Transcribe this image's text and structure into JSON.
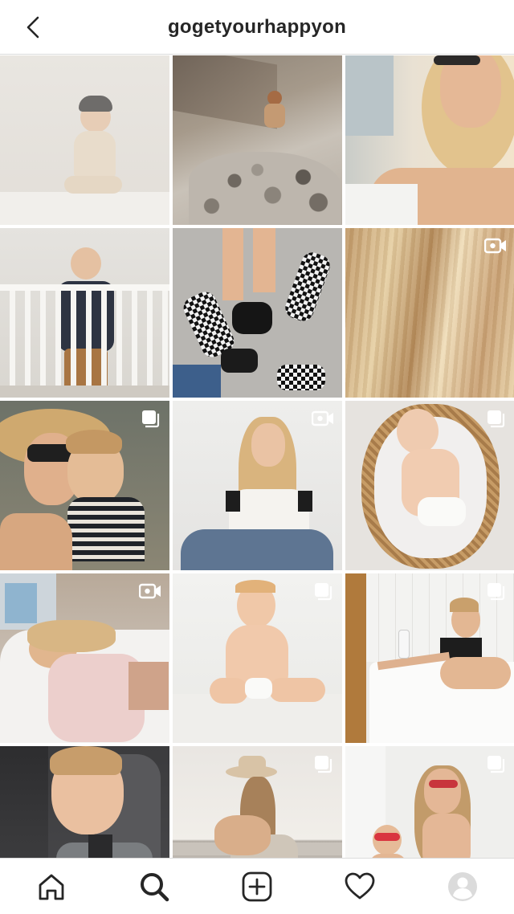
{
  "header": {
    "title": "gogetyourhappyon",
    "back_icon": "chevron-left-icon"
  },
  "grid": {
    "posts": [
      {
        "id": "post-1",
        "subject": "baby-sitting-white-room",
        "badge": "none"
      },
      {
        "id": "post-2",
        "subject": "toddler-on-rocks",
        "badge": "none"
      },
      {
        "id": "post-3",
        "subject": "woman-sunglasses-lying",
        "badge": "none"
      },
      {
        "id": "post-4",
        "subject": "toddler-in-crib",
        "badge": "none"
      },
      {
        "id": "post-5",
        "subject": "checkered-shoes",
        "badge": "none"
      },
      {
        "id": "post-6",
        "subject": "blonde-hair-closeup",
        "badge": "video"
      },
      {
        "id": "post-7",
        "subject": "selfie-mom-and-son",
        "badge": "carousel"
      },
      {
        "id": "post-8",
        "subject": "woman-sitting-smiling",
        "badge": "video"
      },
      {
        "id": "post-9",
        "subject": "baby-in-basket",
        "badge": "carousel"
      },
      {
        "id": "post-10",
        "subject": "hospital-bed",
        "badge": "video"
      },
      {
        "id": "post-11",
        "subject": "baby-cake-smash",
        "badge": "carousel"
      },
      {
        "id": "post-12",
        "subject": "pregnant-woman-bathtub",
        "badge": "carousel"
      },
      {
        "id": "post-13",
        "subject": "toddler-car-seat",
        "badge": "none"
      },
      {
        "id": "post-14",
        "subject": "mother-baby-beach",
        "badge": "carousel"
      },
      {
        "id": "post-15",
        "subject": "mom-son-heart-sunglasses",
        "badge": "carousel"
      }
    ]
  },
  "tabbar": {
    "items": [
      {
        "name": "home-tab",
        "icon": "home-icon"
      },
      {
        "name": "search-tab",
        "icon": "search-icon",
        "active": true
      },
      {
        "name": "create-tab",
        "icon": "plus-square-icon"
      },
      {
        "name": "activity-tab",
        "icon": "heart-icon"
      },
      {
        "name": "profile-tab",
        "icon": "avatar-icon"
      }
    ]
  },
  "colors": {
    "text": "#262626",
    "divider": "#dbdbdb",
    "background": "#ffffff"
  }
}
